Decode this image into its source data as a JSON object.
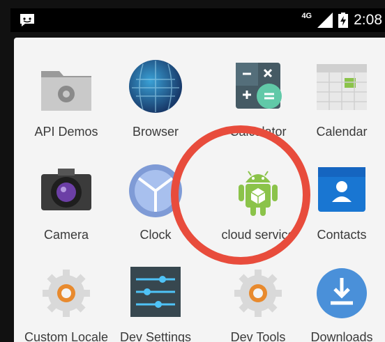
{
  "status_bar": {
    "network": "4G",
    "time": "2:08"
  },
  "apps": [
    {
      "label": "API Demos",
      "icon": "folder-gear-icon"
    },
    {
      "label": "Browser",
      "icon": "globe-icon"
    },
    {
      "label": "Calculator",
      "icon": "calculator-icon"
    },
    {
      "label": "Calendar",
      "icon": "calendar-icon"
    },
    {
      "label": "Camera",
      "icon": "camera-icon"
    },
    {
      "label": "Clock",
      "icon": "clock-icon"
    },
    {
      "label": "cloud service",
      "icon": "android-icon"
    },
    {
      "label": "Contacts",
      "icon": "contacts-icon"
    },
    {
      "label": "Custom Locale",
      "icon": "gear-icon"
    },
    {
      "label": "Dev Settings",
      "icon": "sliders-icon"
    },
    {
      "label": "Dev Tools",
      "icon": "gear-icon"
    },
    {
      "label": "Downloads",
      "icon": "download-icon"
    }
  ],
  "colors": {
    "highlight_ring": "#e84c3c",
    "downloads": "#4a90d9",
    "android": "#8bc34a"
  }
}
